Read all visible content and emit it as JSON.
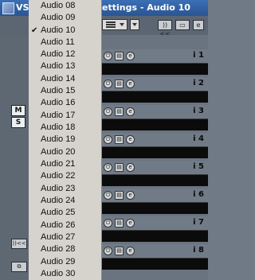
{
  "window": {
    "title_left": "VS",
    "title_right": "ettings - Audio 10"
  },
  "toolbar": {
    "btn_a": "))<<",
    "btn_b": "▭"
  },
  "leftstrip": {
    "box_m": "M",
    "box_s": "S",
    "btn_c": "))<<",
    "btn_d": "⧉"
  },
  "menu": {
    "items": [
      "Audio 08",
      "Audio 09",
      "Audio 10",
      "Audio 11",
      "Audio 12",
      "Audio 13",
      "Audio 14",
      "Audio 15",
      "Audio 16",
      "Audio 17",
      "Audio 18",
      "Audio 19",
      "Audio 20",
      "Audio 21",
      "Audio 22",
      "Audio 23",
      "Audio 24",
      "Audio 25",
      "Audio 26",
      "Audio 27",
      "Audio 28",
      "Audio 29",
      "Audio 30"
    ],
    "checked": "Audio 10"
  },
  "tracks": [
    "i 1",
    "i 2",
    "i 3",
    "i 4",
    "i 5",
    "i 6",
    "i 7",
    "i 8"
  ],
  "icons": {
    "power": "⏻",
    "read": "▤",
    "edit": "e"
  }
}
